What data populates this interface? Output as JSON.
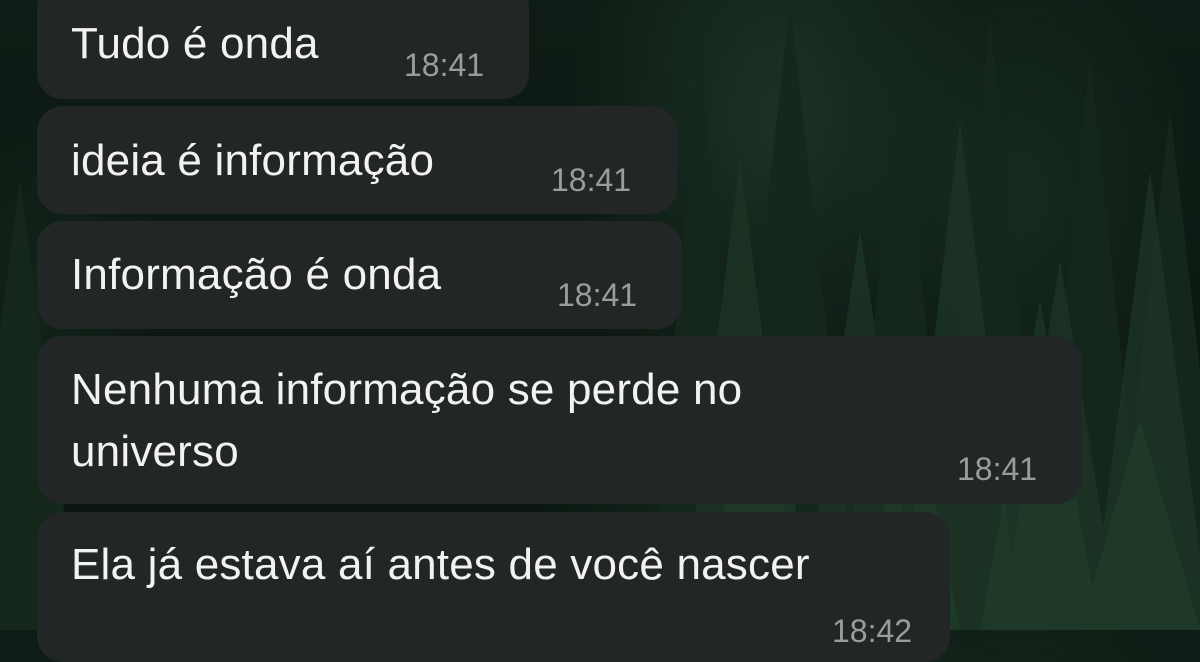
{
  "conversation": {
    "messages": [
      {
        "text": "Tudo é onda",
        "time": "18:41"
      },
      {
        "text": "ideia é informação",
        "time": "18:41"
      },
      {
        "text": "Informação é onda",
        "time": "18:41"
      },
      {
        "text_line1": "Nenhuma informação se perde no",
        "text_line2": "universo",
        "time": "18:41"
      },
      {
        "text": "Ela já estava aí antes de você nascer",
        "time": "18:42"
      }
    ]
  }
}
